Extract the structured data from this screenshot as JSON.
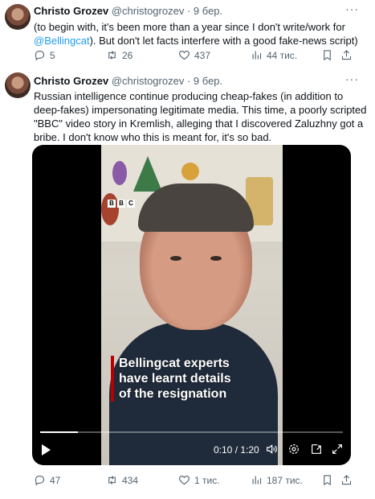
{
  "tweets": [
    {
      "name": "Christo Grozev",
      "handle": "@christogrozev",
      "time": "9 бер.",
      "text_before_link": "(to begin with, it's been more than a year since I don't write/work for ",
      "link": "@Bellingcat",
      "text_after_link": "). But don't let facts interfere with a good fake-news script)",
      "replies": "5",
      "retweets": "26",
      "likes": "437",
      "views": "44 тис."
    },
    {
      "name": "Christo Grozev",
      "handle": "@christogrozev",
      "time": "9 бер.",
      "text": "Russian intelligence continue producing cheap-fakes (in addition to deep-fakes) impersonating legitimate media. This time, a poorly scripted \"BBC\" video story in Kremlish, alleging that I discovered Zaluzhny got a bribe. I don't know who this is meant for, it's so bad.",
      "video": {
        "logo_letters": [
          "B",
          "B",
          "C"
        ],
        "caption_lines": [
          "Bellingcat experts",
          "have learnt details",
          "of the resignation"
        ],
        "timecode": "0:10 / 1:20",
        "progress": 0.125
      },
      "replies": "47",
      "retweets": "434",
      "likes": "1 тис.",
      "views": "187 тис."
    }
  ],
  "icons": {
    "more": "more-icon",
    "reply": "reply-icon",
    "retweet": "retweet-icon",
    "like": "heart-icon",
    "views": "views-icon",
    "bookmark": "bookmark-icon",
    "share": "share-icon"
  },
  "colors": {
    "link": "#1d9bf0",
    "muted": "#536471",
    "bbc_red": "#b80000"
  }
}
